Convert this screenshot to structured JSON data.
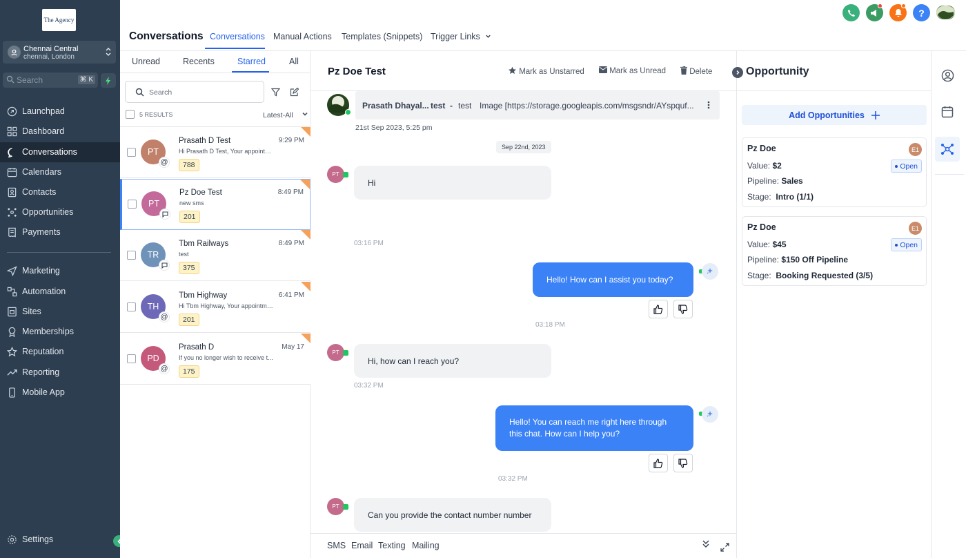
{
  "brand": {
    "logo_text": "The Agency"
  },
  "location": {
    "name": "Chennai Central",
    "sub": "chennai, London"
  },
  "sidebar": {
    "search_placeholder": "Search",
    "shortcut": "⌘ K",
    "nav": [
      {
        "label": "Launchpad",
        "icon": "rocket-icon"
      },
      {
        "label": "Dashboard",
        "icon": "grid-icon"
      },
      {
        "label": "Conversations",
        "icon": "chat-icon",
        "active": true
      },
      {
        "label": "Calendars",
        "icon": "calendar-icon"
      },
      {
        "label": "Contacts",
        "icon": "contacts-icon"
      },
      {
        "label": "Opportunities",
        "icon": "funnel-icon"
      },
      {
        "label": "Payments",
        "icon": "receipt-icon"
      },
      {
        "label": "Marketing",
        "icon": "send-icon"
      },
      {
        "label": "Automation",
        "icon": "automation-icon"
      },
      {
        "label": "Sites",
        "icon": "globe-icon"
      },
      {
        "label": "Memberships",
        "icon": "badge-icon"
      },
      {
        "label": "Reputation",
        "icon": "star-icon"
      },
      {
        "label": "Reporting",
        "icon": "trend-icon"
      },
      {
        "label": "Mobile App",
        "icon": "phone-icon"
      }
    ],
    "settings": "Settings"
  },
  "header": {
    "title": "Conversations",
    "tabs": [
      "Conversations",
      "Manual Actions",
      "Templates (Snippets)",
      "Trigger Links"
    ],
    "icon_colors": {
      "phone": "#3ab07c",
      "megaphone": "#3a9b63",
      "bell": "#f97316",
      "help": "#3b82f6"
    }
  },
  "list": {
    "filters": [
      "Unread",
      "Recents",
      "Starred",
      "All"
    ],
    "search_placeholder": "Search",
    "results": "5 RESULTS",
    "sort": "Latest-All",
    "items": [
      {
        "initials": "PT",
        "name": "Prasath D Test",
        "preview": "Hi Prasath D Test, Your appointment",
        "time": "9:29 PM",
        "tag": "788",
        "color": "#c0806a",
        "channel": "@"
      },
      {
        "initials": "PT",
        "name": "Pz Doe Test",
        "preview": "new sms",
        "time": "8:49 PM",
        "tag": "201",
        "color": "#c46a9a",
        "channel": "sms",
        "selected": true
      },
      {
        "initials": "TR",
        "name": "Tbm Railways",
        "preview": "test",
        "time": "8:49 PM",
        "tag": "375",
        "color": "#6f92b8",
        "channel": "sms"
      },
      {
        "initials": "TH",
        "name": "Tbm Highway",
        "preview": "Hi Tbm Highway, Your appointment",
        "time": "6:41 PM",
        "tag": "201",
        "color": "#6e68b8",
        "channel": "@"
      },
      {
        "initials": "PD",
        "name": "Prasath D",
        "preview": "If you no longer wish to receive t...",
        "time": "May 17",
        "tag": "175",
        "color": "#c4597a",
        "channel": "@"
      }
    ]
  },
  "chat": {
    "title": "Pz Doe Test",
    "actions": [
      "Mark as Unstarred",
      "Mark as Unread",
      "Delete"
    ],
    "email": {
      "sender": "Prasath Dhayal...",
      "subject": "test",
      "sep": "-",
      "body": "test",
      "attachment": "Image [https://storage.googleapis.com/msgsndr/AYspquf...",
      "date": "21st Sep 2023, 5:25 pm"
    },
    "date_pill": "Sep 22nd, 2023",
    "messages": [
      {
        "dir": "in",
        "text": "Hi",
        "time": "03:16 PM"
      },
      {
        "dir": "out",
        "text": "Hello! How can I assist you today?",
        "time": "03:18 PM"
      },
      {
        "dir": "in",
        "text": "Hi, how can I reach you?",
        "time": "03:32 PM"
      },
      {
        "dir": "out",
        "text": "Hello! You can reach me right here through this chat. How can I help you?",
        "time": "03:32 PM"
      },
      {
        "dir": "in",
        "text": "Can you provide the contact number number",
        "time": ""
      }
    ],
    "avatar_initials": "PT",
    "footer_tabs": [
      "SMS",
      "Email",
      "Texting",
      "Mailing"
    ]
  },
  "opportunity": {
    "title": "Opportunity",
    "add_label": "Add Opportunities",
    "cards": [
      {
        "name": "Pz Doe",
        "badge": "E1",
        "status": "Open",
        "value": "$2",
        "pipeline": "Sales",
        "stage": "Intro (1/1)"
      },
      {
        "name": "Pz Doe",
        "badge": "E1",
        "status": "Open",
        "value": "$45",
        "pipeline": "$150 Off Pipeline",
        "stage": "Booking Requested (3/5)"
      }
    ],
    "labels": {
      "value": "Value:",
      "pipeline": "Pipeline:",
      "stage": "Stage:"
    }
  }
}
